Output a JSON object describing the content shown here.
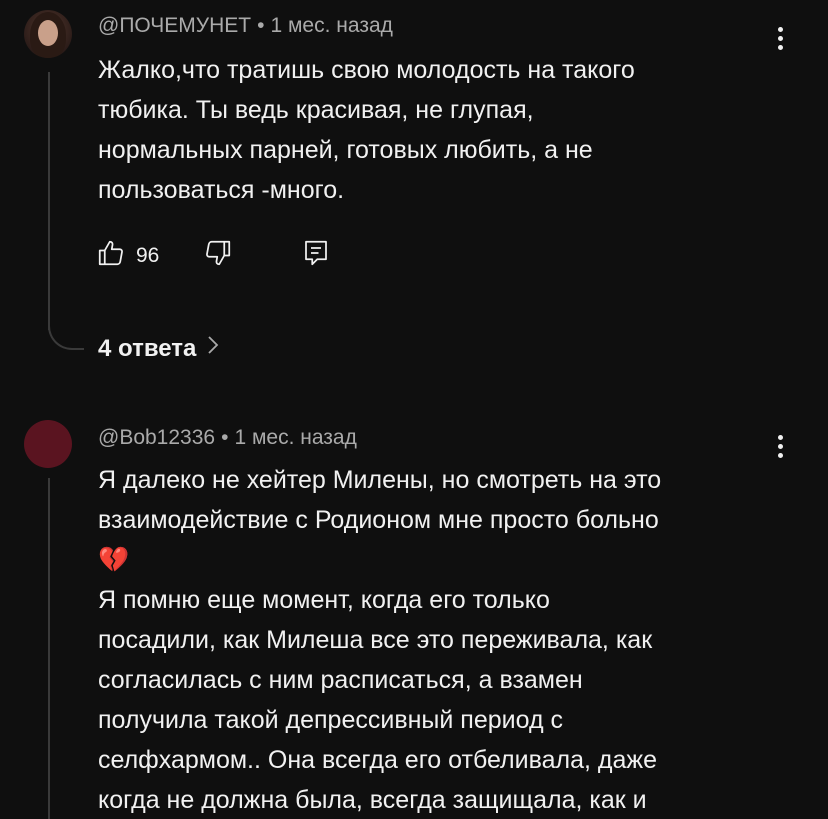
{
  "comments": [
    {
      "author": "@ПОЧЕМУНЕТ",
      "separator": "•",
      "time": "1 мес. назад",
      "text_lines": [
        "Жалко,что тратишь свою молодость на такого",
        "тюбика. Ты ведь красивая, не глупая,",
        "нормальных парней, готовых любить, а не",
        "пользоваться -много."
      ],
      "like_count": "96",
      "replies_label": "4 ответа",
      "icons": {
        "like": "thumb-up-icon",
        "dislike": "thumb-down-icon",
        "reply": "reply-icon",
        "more": "more-vert-icon",
        "chevron": "chevron-right-icon"
      }
    },
    {
      "author": "@Bob12336",
      "separator": "•",
      "time": "1 мес. назад",
      "text_lines": [
        "Я далеко не хейтер Милены, но смотреть на это",
        "взаимодействие с Родионом мне просто больно",
        "💔",
        "Я помню еще момент, когда его только",
        "посадили, как Милеша все это переживала, как",
        "согласилась с ним расписаться, а взамен",
        "получила такой депрессивный период с",
        "селфхармом.. Она всегда его отбеливала, даже",
        "когда не должна была, всегда защищала, как и"
      ],
      "avatar_color": "#5a1420",
      "icons": {
        "more": "more-vert-icon"
      }
    }
  ]
}
